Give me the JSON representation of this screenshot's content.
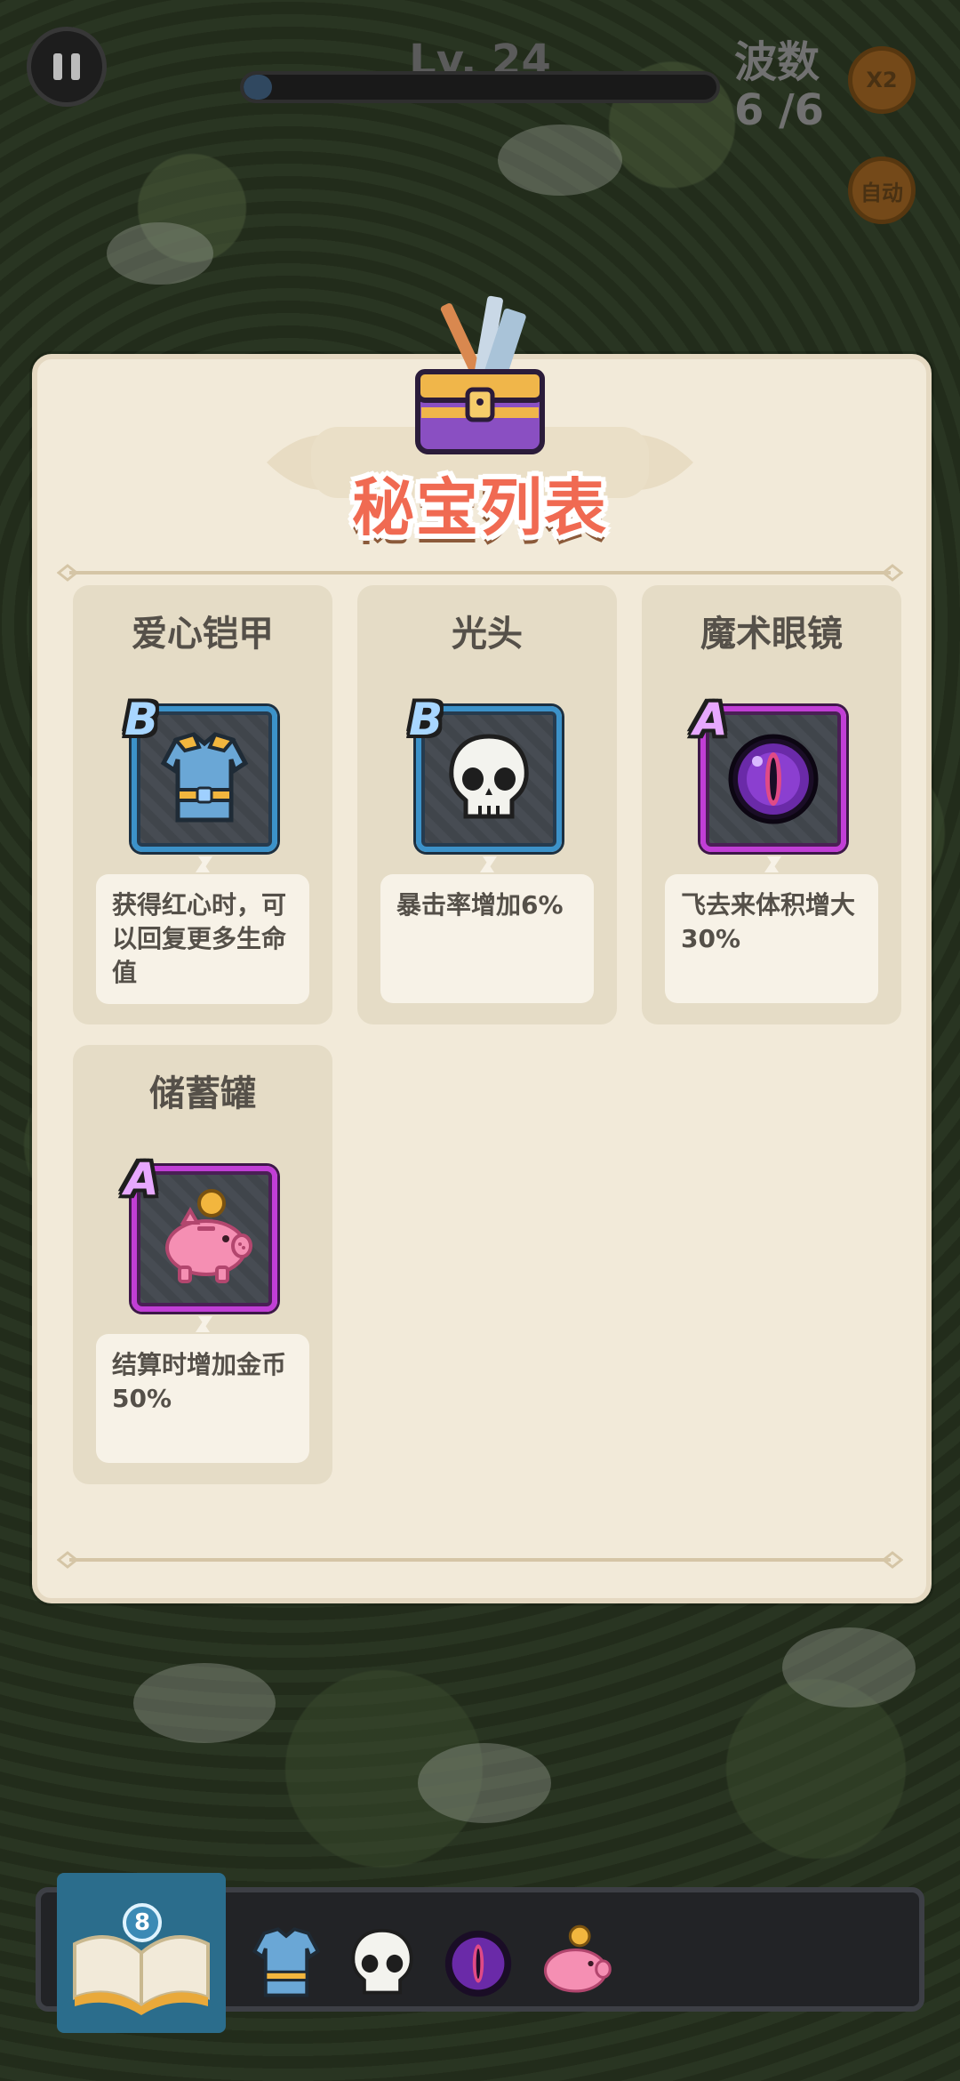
{
  "hud": {
    "level": "Lv. 24",
    "level_progress": 0.02,
    "wave_label": "波数",
    "wave_value": "6 /6",
    "speed_button": "X2",
    "auto_button": "自动"
  },
  "modal": {
    "title": "秘宝列表",
    "items": [
      {
        "name": "爱心铠甲",
        "rank": "B",
        "icon": "chest-armor-icon",
        "desc": "获得红心时，可以回复更多生命值"
      },
      {
        "name": "光头",
        "rank": "B",
        "icon": "skull-icon",
        "desc": "暴击率增加6%"
      },
      {
        "name": "魔术眼镜",
        "rank": "A",
        "icon": "magic-eye-icon",
        "desc": "飞去来体积增大30%"
      },
      {
        "name": "储蓄罐",
        "rank": "A",
        "icon": "piggy-bank-icon",
        "desc": "结算时增加金币50%"
      }
    ]
  },
  "bottom_bar": {
    "book_count": "8",
    "owned_icons": [
      "chest-armor-icon",
      "skull-icon",
      "magic-eye-icon",
      "piggy-bank-icon"
    ]
  },
  "colors": {
    "rank_b": "#3c92c9",
    "rank_a": "#c13ed6",
    "title": "#f06a52",
    "panel": "#f2ead9"
  }
}
